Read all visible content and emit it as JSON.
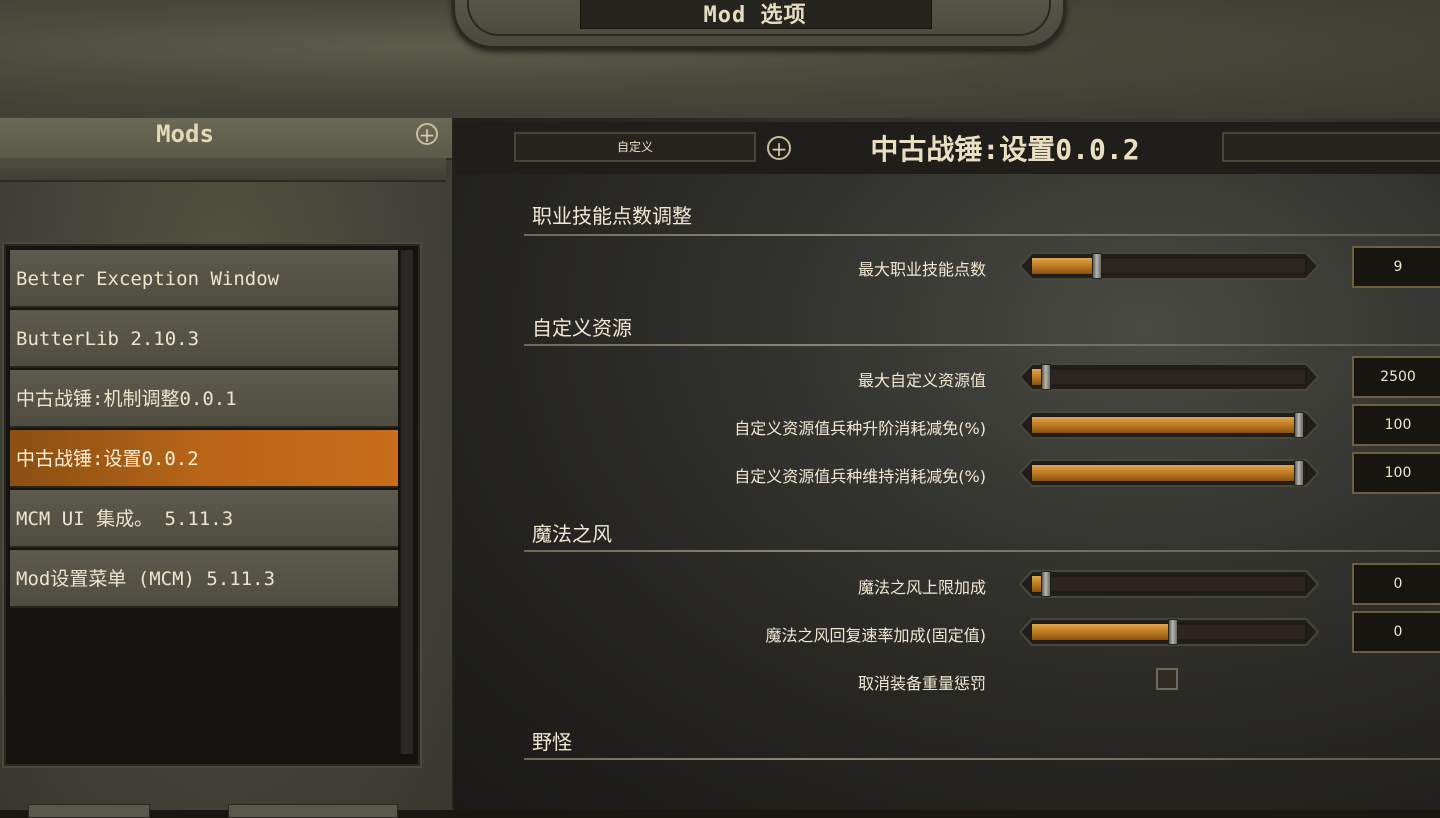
{
  "window": {
    "title": "Mod 选项"
  },
  "left_panel": {
    "header": "Mods",
    "mods": [
      {
        "label": "Better Exception Window",
        "selected": false
      },
      {
        "label": "ButterLib 2.10.3",
        "selected": false
      },
      {
        "label": "中古战锤:机制调整0.0.1",
        "selected": false
      },
      {
        "label": "中古战锤:设置0.0.2",
        "selected": true
      },
      {
        "label": "MCM UI 集成。 5.11.3",
        "selected": false
      },
      {
        "label": "Mod设置菜单 (MCM) 5.11.3",
        "selected": false
      }
    ]
  },
  "right_panel": {
    "preset_dropdown": "自定义",
    "settings_title": "中古战锤:设置0.0.2",
    "sections": [
      {
        "title": "职业技能点数调整",
        "settings": [
          {
            "label": "最大职业技能点数",
            "value": "9",
            "fill": 0.2
          }
        ]
      },
      {
        "title": "自定义资源",
        "settings": [
          {
            "label": "最大自定义资源值",
            "value": "2500",
            "fill": 0.0
          },
          {
            "label": "自定义资源值兵种升阶消耗减免(%)",
            "value": "100",
            "fill": 1.0
          },
          {
            "label": "自定义资源值兵种维持消耗减免(%)",
            "value": "100",
            "fill": 1.0
          }
        ]
      },
      {
        "title": "魔法之风",
        "settings": [
          {
            "label": "魔法之风上限加成",
            "value": "0",
            "fill": 0.0
          },
          {
            "label": "魔法之风回复速率加成(固定值)",
            "value": "0",
            "fill": 0.5
          }
        ],
        "checkbox": {
          "label": "取消装备重量惩罚",
          "checked": false
        }
      },
      {
        "title": "野怪",
        "settings": []
      }
    ]
  },
  "colors": {
    "accent": "#c2731c",
    "text": "#f0e8d2",
    "stone": "#4d4d3f"
  }
}
